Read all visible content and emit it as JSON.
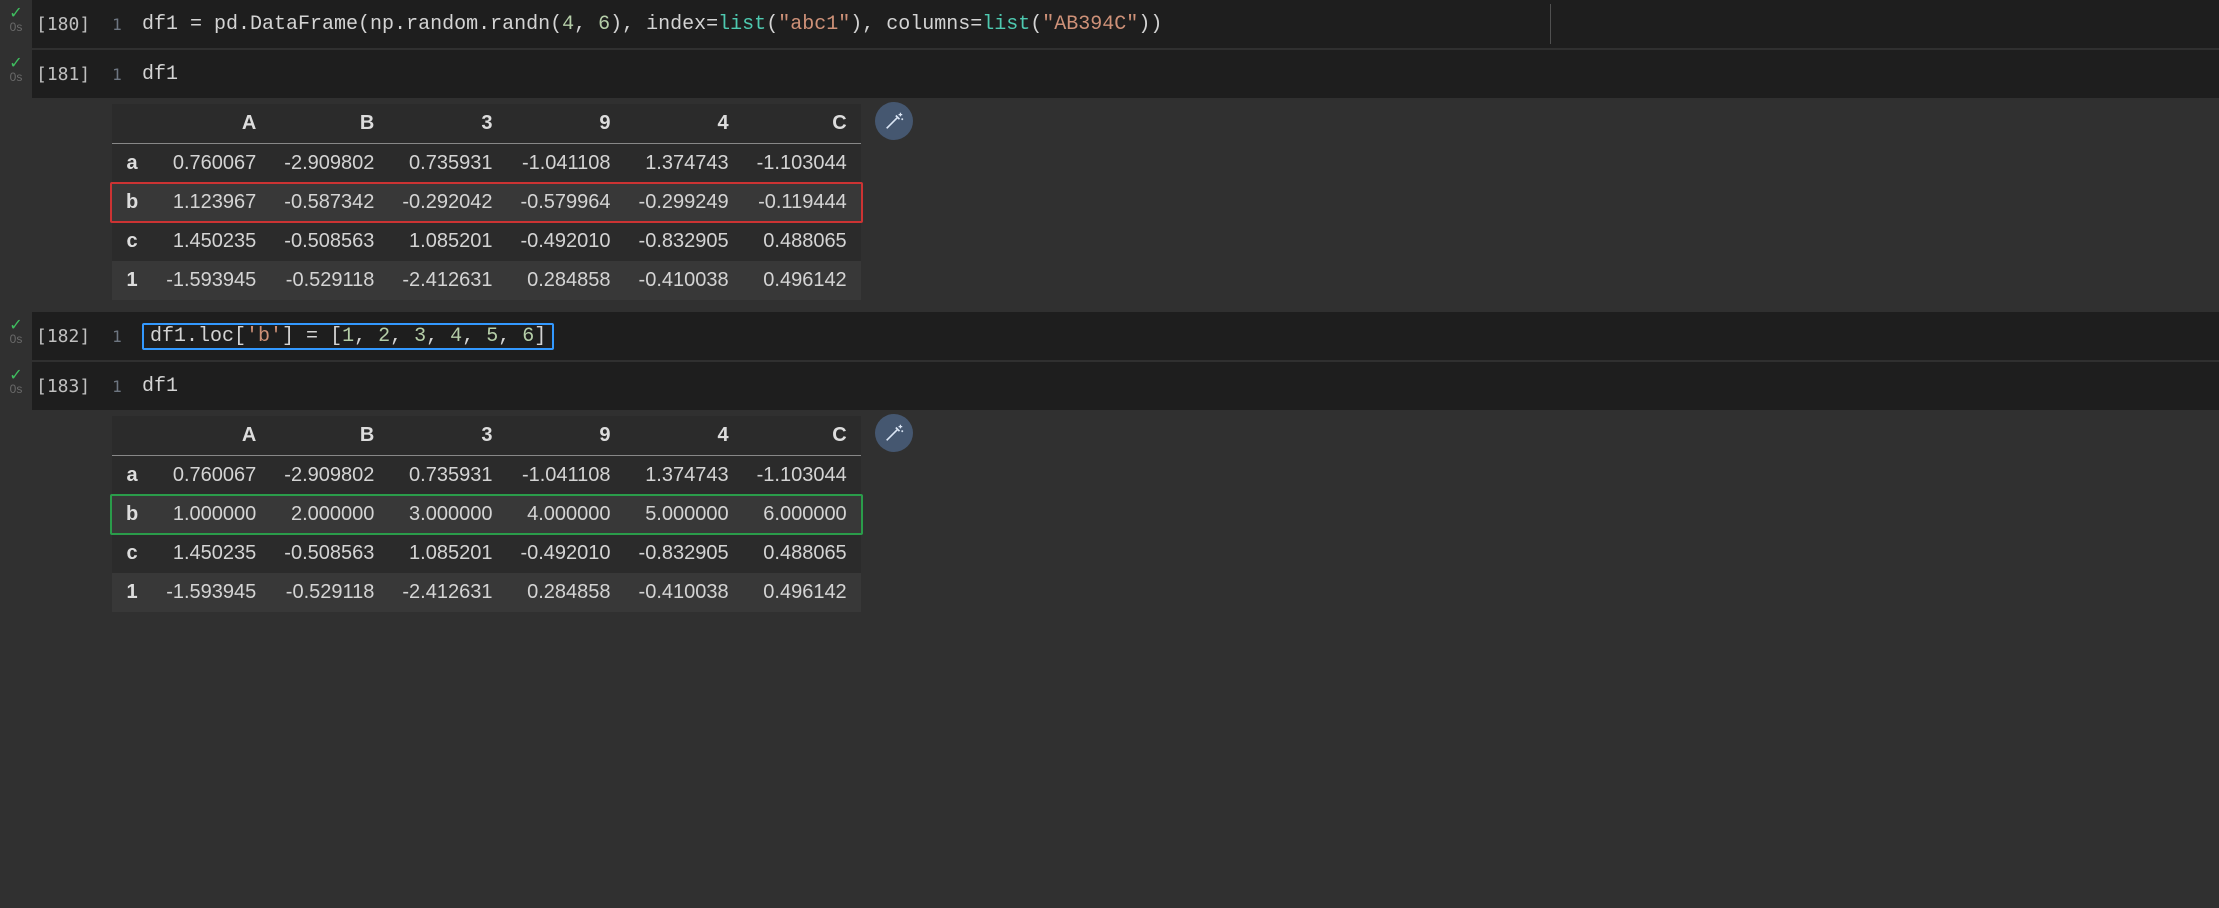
{
  "gutter": {
    "check": "✓",
    "time": "0s",
    "line_num": "1"
  },
  "cells": [
    {
      "exec": "[180]",
      "code_tokens": [
        {
          "t": "df1 ",
          "c": ""
        },
        {
          "t": "=",
          "c": ""
        },
        {
          "t": " pd.DataFrame(np.random.randn(",
          "c": ""
        },
        {
          "t": "4",
          "c": "num"
        },
        {
          "t": ", ",
          "c": ""
        },
        {
          "t": "6",
          "c": "num"
        },
        {
          "t": "), index",
          "c": ""
        },
        {
          "t": "=",
          "c": ""
        },
        {
          "t": "list",
          "c": "tp"
        },
        {
          "t": "(",
          "c": ""
        },
        {
          "t": "\"abc1\"",
          "c": "str"
        },
        {
          "t": "), columns",
          "c": ""
        },
        {
          "t": "=",
          "c": ""
        },
        {
          "t": "list",
          "c": "tp"
        },
        {
          "t": "(",
          "c": ""
        },
        {
          "t": "\"AB394C\"",
          "c": "str"
        },
        {
          "t": "))",
          "c": ""
        }
      ]
    },
    {
      "exec": "[181]",
      "code_tokens": [
        {
          "t": "df1",
          "c": ""
        }
      ]
    },
    {
      "exec": "[182]",
      "boxed": true,
      "code_tokens": [
        {
          "t": "df1.loc[",
          "c": ""
        },
        {
          "t": "'b'",
          "c": "str"
        },
        {
          "t": "] ",
          "c": ""
        },
        {
          "t": "=",
          "c": ""
        },
        {
          "t": " [",
          "c": ""
        },
        {
          "t": "1",
          "c": "num"
        },
        {
          "t": ", ",
          "c": ""
        },
        {
          "t": "2",
          "c": "num"
        },
        {
          "t": ", ",
          "c": ""
        },
        {
          "t": "3",
          "c": "num"
        },
        {
          "t": ", ",
          "c": ""
        },
        {
          "t": "4",
          "c": "num"
        },
        {
          "t": ", ",
          "c": ""
        },
        {
          "t": "5",
          "c": "num"
        },
        {
          "t": ", ",
          "c": ""
        },
        {
          "t": "6",
          "c": "num"
        },
        {
          "t": "]",
          "c": ""
        }
      ]
    },
    {
      "exec": "[183]",
      "code_tokens": [
        {
          "t": "df1",
          "c": ""
        }
      ]
    }
  ],
  "tables": [
    {
      "highlight_row": 1,
      "highlight_color": "red",
      "cols": [
        "A",
        "B",
        "3",
        "9",
        "4",
        "C"
      ],
      "idx": [
        "a",
        "b",
        "c",
        "1"
      ],
      "rows": [
        [
          "0.760067",
          "-2.909802",
          "0.735931",
          "-1.041108",
          "1.374743",
          "-1.103044"
        ],
        [
          "1.123967",
          "-0.587342",
          "-0.292042",
          "-0.579964",
          "-0.299249",
          "-0.119444"
        ],
        [
          "1.450235",
          "-0.508563",
          "1.085201",
          "-0.492010",
          "-0.832905",
          "0.488065"
        ],
        [
          "-1.593945",
          "-0.529118",
          "-2.412631",
          "0.284858",
          "-0.410038",
          "0.496142"
        ]
      ]
    },
    {
      "highlight_row": 1,
      "highlight_color": "green",
      "cols": [
        "A",
        "B",
        "3",
        "9",
        "4",
        "C"
      ],
      "idx": [
        "a",
        "b",
        "c",
        "1"
      ],
      "rows": [
        [
          "0.760067",
          "-2.909802",
          "0.735931",
          "-1.041108",
          "1.374743",
          "-1.103044"
        ],
        [
          "1.000000",
          "2.000000",
          "3.000000",
          "4.000000",
          "5.000000",
          "6.000000"
        ],
        [
          "1.450235",
          "-0.508563",
          "1.085201",
          "-0.492010",
          "-0.832905",
          "0.488065"
        ],
        [
          "-1.593945",
          "-0.529118",
          "-2.412631",
          "0.284858",
          "-0.410038",
          "0.496142"
        ]
      ]
    }
  ]
}
